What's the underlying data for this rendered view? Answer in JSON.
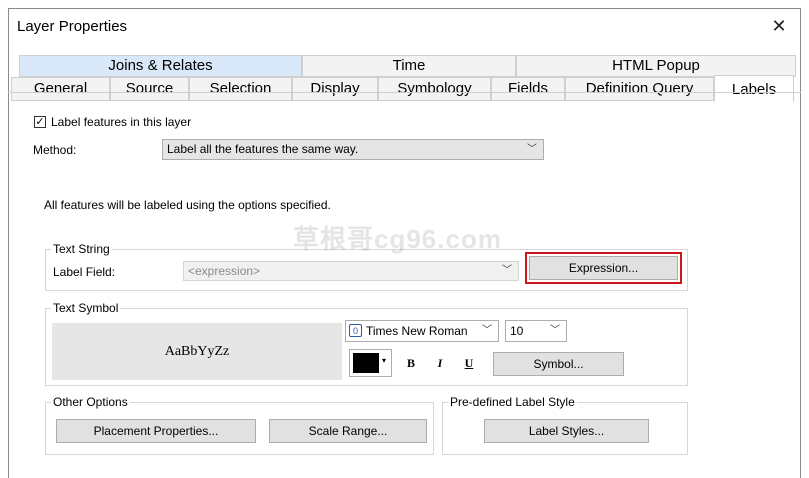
{
  "window": {
    "title": "Layer Properties"
  },
  "tabs": {
    "row1": [
      "Joins & Relates",
      "Time",
      "HTML Popup"
    ],
    "row2": [
      "General",
      "Source",
      "Selection",
      "Display",
      "Symbology",
      "Fields",
      "Definition Query",
      "Labels"
    ],
    "active": "Labels"
  },
  "labels_tab": {
    "label_features_checkbox": {
      "label": "Label features in this layer",
      "checked": true,
      "mark": "✓"
    },
    "method": {
      "label": "Method:",
      "value": "Label all the features the same way."
    },
    "info_text": "All features will be labeled using the options specified.",
    "text_string": {
      "group_label": "Text String",
      "field_label": "Label Field:",
      "field_value": "<expression>",
      "expression_button": "Expression..."
    },
    "text_symbol": {
      "group_label": "Text Symbol",
      "preview_text": "AaBbYyZz",
      "font": "Times New Roman",
      "font_icon_glyph": "0",
      "size": "10",
      "color": "#000000",
      "bold": "B",
      "italic": "I",
      "underline": "U",
      "symbol_button": "Symbol..."
    },
    "other_options": {
      "group_label": "Other Options",
      "placement_button": "Placement Properties...",
      "scale_button": "Scale Range..."
    },
    "predefined": {
      "group_label": "Pre-defined Label Style",
      "label_styles_button": "Label Styles..."
    }
  },
  "watermark": "草根哥cg96.com",
  "colors": {
    "highlight_border": "#d0141e",
    "tab_highlight": "#d9e8f8"
  }
}
